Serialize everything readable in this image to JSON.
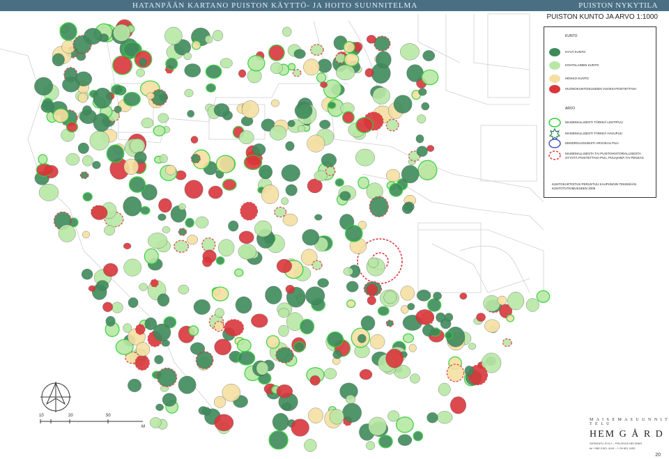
{
  "header": {
    "title": "HATANPÄÄN KARTANO PUISTON KÄYTTÖ- JA HOITO SUUNNITELMA",
    "section": "PUISTON NYKYTILA",
    "subtitle": "PUISTON KUNTO JA ARVO 1:1000"
  },
  "legend": {
    "condition_heading": "KUNTO",
    "condition_items": [
      {
        "label": "HYVÄ KUNTO",
        "color": "#3f8a5c"
      },
      {
        "label": "KOHTALAINEN KUNTO",
        "color": "#b9e8a6"
      },
      {
        "label": "HEIKKO KUNTO",
        "color": "#f5e0a3"
      },
      {
        "label": "HUONOKUNTOISUUDEN VUOKSI POISTETTAVA",
        "color": "#d9363b"
      }
    ],
    "value_heading": "ARVO",
    "value_items": [
      {
        "label": "MAISEMALLISESTI TÄRKEÄ LEHTIPUU",
        "color": "#2fcf35",
        "icon": "green-ring-icon"
      },
      {
        "label": "MAISEMALLISESTI TÄRKEÄ HAVUPUU",
        "color": "#2a7a55",
        "icon": "conifer-star-icon"
      },
      {
        "label": "DENDROLOGISESTI ARVOKAS PUU",
        "color": "#4a52c8",
        "icon": "blue-ring-icon"
      },
      {
        "label": "MAISEMALLISESTA TAI PUISTOHISTORIALLISESTA SYYSTÄ POISTETTAVA PUU, PUUryHMÄ TAI PENSAS",
        "color": "#d9363b",
        "icon": "red-dashed-ring-icon"
      }
    ],
    "note": "KUNTOKARTOITUS PERUSTUU KAUPUNGIN TEKEMÄÄN KUNTOTUTKIMUKSEEN 2009"
  },
  "scale": {
    "ticks": [
      "10",
      "20",
      "50"
    ],
    "unit": "M"
  },
  "brand": {
    "studio": "M A I S E M A S U U N N I T T E L U",
    "name": "HEM G Å R D",
    "address": "SATAKATU 20 A 2 – FIN-00100 HELSINKI",
    "phone": "tel +358 9 621 4144 – f. 09 621 4150"
  },
  "page_number": "20"
}
